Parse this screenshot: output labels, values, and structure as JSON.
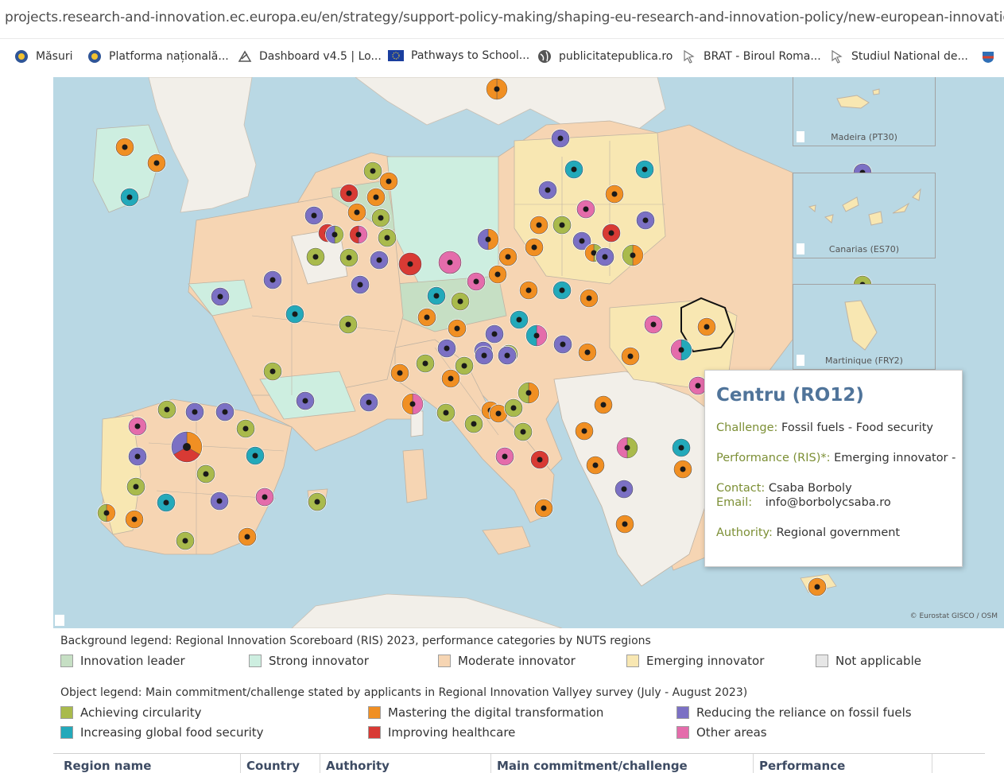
{
  "browser": {
    "url": "projects.research-and-innovation.ec.europa.eu/en/strategy/support-policy-making/shaping-eu-research-and-innovation-policy/new-european-innovation-agenda/",
    "bookmarks": [
      {
        "label": "Măsuri",
        "icon": "romanian-gov-icon"
      },
      {
        "label": "Platforma națională...",
        "icon": "romanian-gov-icon"
      },
      {
        "label": "Dashboard v4.5 | Lo...",
        "icon": "dashboard-icon"
      },
      {
        "label": "Pathways to School...",
        "icon": "eu-flag-icon"
      },
      {
        "label": "publicitatepublica.ro",
        "icon": "globe-icon"
      },
      {
        "label": "BRAT - Biroul Roma...",
        "icon": "cursor-icon"
      },
      {
        "label": "Studiul National de...",
        "icon": "cursor-icon"
      }
    ]
  },
  "colors": {
    "innovation_leader": "#c6dfc4",
    "strong_innovator": "#cdeee0",
    "moderate_innovator": "#f6d5b3",
    "emerging_innovator": "#f8e7b2",
    "not_applicable": "#e6e6e6",
    "circularity": "#a9ba4c",
    "digital": "#f08f23",
    "fossil": "#7b70c4",
    "food": "#23a9ba",
    "health": "#d83a34",
    "other": "#e46cab"
  },
  "map": {
    "insets": [
      {
        "label": "Madeira (PT30)"
      },
      {
        "label": "Canarias (ES70)"
      },
      {
        "label": "Martinique (FRY2)"
      }
    ],
    "credit": "© Eurostat GISCO / OSM"
  },
  "tooltip": {
    "title": "Centru (RO12)",
    "challenge_label": "Challenge:",
    "challenge_value": "Fossil fuels - Food security",
    "performance_label": "Performance (RIS)*:",
    "performance_value": "Emerging innovator -",
    "contact_label": "Contact:",
    "contact_value": "Csaba Borboly",
    "email_label": "Email:",
    "email_value": "info@borbolycsaba.ro",
    "authority_label": "Authority:",
    "authority_value": "Regional government"
  },
  "background_legend": {
    "title": "Background legend: Regional Innovation Scoreboard (RIS) 2023, performance categories by NUTS  regions",
    "items": [
      "Innovation leader",
      "Strong innovator",
      "Moderate innovator",
      "Emerging innovator",
      "Not applicable"
    ]
  },
  "object_legend": {
    "title": "Object legend: Main commitment/challenge stated by applicants in Regional Innovation Vallyey survey (July - August 2023)",
    "items": [
      "Achieving circularity",
      "Mastering the digital transformation",
      "Reducing the reliance on fossil fuels",
      "Increasing global food security",
      "Improving healthcare",
      "Other areas"
    ]
  },
  "table": {
    "columns": [
      "Region name",
      "Country",
      "Authority",
      "Main commitment/challenge",
      "Performance"
    ]
  }
}
